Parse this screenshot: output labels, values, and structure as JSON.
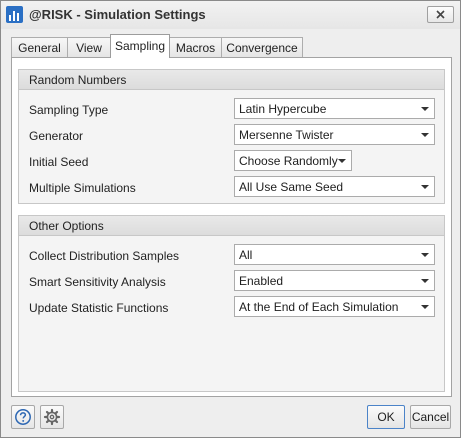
{
  "window": {
    "title": "@RISK - Simulation Settings"
  },
  "tabs": [
    {
      "label": "General",
      "active": false
    },
    {
      "label": "View",
      "active": false
    },
    {
      "label": "Sampling",
      "active": true
    },
    {
      "label": "Macros",
      "active": false
    },
    {
      "label": "Convergence",
      "active": false
    }
  ],
  "random_numbers": {
    "title": "Random Numbers",
    "sampling_type": {
      "label": "Sampling Type",
      "value": "Latin Hypercube"
    },
    "generator": {
      "label": "Generator",
      "value": "Mersenne Twister"
    },
    "initial_seed": {
      "label": "Initial Seed",
      "value": "Choose Randomly"
    },
    "multiple_simulations": {
      "label": "Multiple Simulations",
      "value": "All Use Same Seed"
    }
  },
  "other_options": {
    "title": "Other Options",
    "collect_distribution_samples": {
      "label": "Collect Distribution Samples",
      "value": "All"
    },
    "smart_sensitivity_analysis": {
      "label": "Smart Sensitivity Analysis",
      "value": "Enabled"
    },
    "update_statistic_functions": {
      "label": "Update Statistic Functions",
      "value": "At the End of Each Simulation"
    }
  },
  "footer": {
    "help_icon": "help-icon",
    "settings_icon": "gear-icon",
    "ok_label": "OK",
    "cancel_label": "Cancel"
  },
  "colors": {
    "accent": "#2a6fc4",
    "default_button_border": "#4b83c8"
  }
}
